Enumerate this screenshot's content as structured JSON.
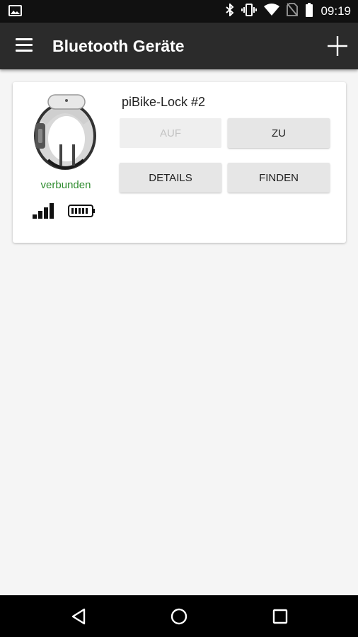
{
  "status_bar": {
    "time": "09:19",
    "icons": [
      "image-icon",
      "bluetooth-icon",
      "vibrate-icon",
      "wifi-icon",
      "no-sim-icon",
      "battery-icon"
    ]
  },
  "app_bar": {
    "title": "Bluetooth Geräte",
    "icons": [
      "menu-icon",
      "add-icon"
    ]
  },
  "device": {
    "name": "piBike-Lock #2",
    "status": "verbunden",
    "status_color": "#2e8b2e",
    "buttons": {
      "auf": "AUF",
      "zu": "ZU",
      "details": "DETAILS",
      "finden": "FINDEN"
    },
    "auf_enabled": false
  },
  "nav_bar": {
    "icons": [
      "back-icon",
      "home-icon",
      "recents-icon"
    ]
  }
}
